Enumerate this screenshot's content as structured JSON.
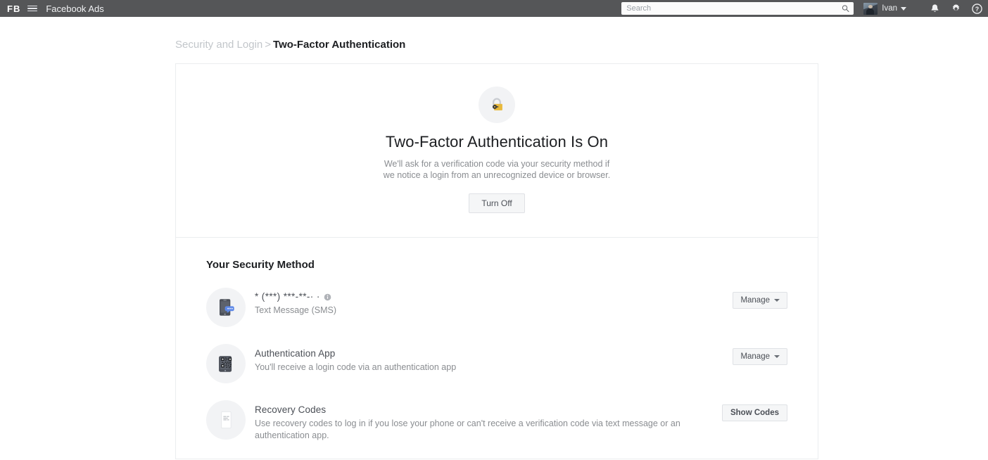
{
  "topbar": {
    "logo": "FB",
    "menu_icon": "hamburger-icon",
    "app_name": "Facebook Ads",
    "search": {
      "placeholder": "Search",
      "value": "",
      "icon": "search-icon"
    },
    "user": {
      "name": "Ivan",
      "avatar": "user-avatar",
      "caret": "chevron-down-icon"
    },
    "icons": [
      {
        "name": "notifications-bell-icon",
        "glyph": "bell"
      },
      {
        "name": "settings-gear-icon",
        "glyph": "gear"
      },
      {
        "name": "help-question-icon",
        "glyph": "question"
      }
    ],
    "background_color": "#555658"
  },
  "breadcrumb": {
    "parent": "Security and Login",
    "separator": ">",
    "current": "Two-Factor Authentication"
  },
  "hero": {
    "icon": "padlock-icon",
    "icon_color": "#e8b93b",
    "title": "Two-Factor Authentication Is On",
    "description": "We'll ask for a verification code via your security method if we notice a login from an unrecognized device or browser.",
    "button_label": "Turn Off"
  },
  "methods": {
    "section_title": "Your Security Method",
    "items": [
      {
        "icon": "sms-phone-icon",
        "title": "* (***) ***-**-· ·",
        "has_info_icon": true,
        "info_icon": "info-icon",
        "subtitle": "Text Message (SMS)",
        "action_label": "Manage",
        "action_type": "dropdown"
      },
      {
        "icon": "qr-code-authenticator-icon",
        "title": "Authentication App",
        "has_info_icon": false,
        "subtitle": "You'll receive a login code via an authentication app",
        "action_label": "Manage",
        "action_type": "dropdown"
      },
      {
        "icon": "recovery-codes-document-icon",
        "title": "Recovery Codes",
        "has_info_icon": false,
        "subtitle": "Use recovery codes to log in if you lose your phone or can't receive a verification code via text message or an authentication app.",
        "action_label": "Show Codes",
        "action_type": "button"
      }
    ]
  }
}
